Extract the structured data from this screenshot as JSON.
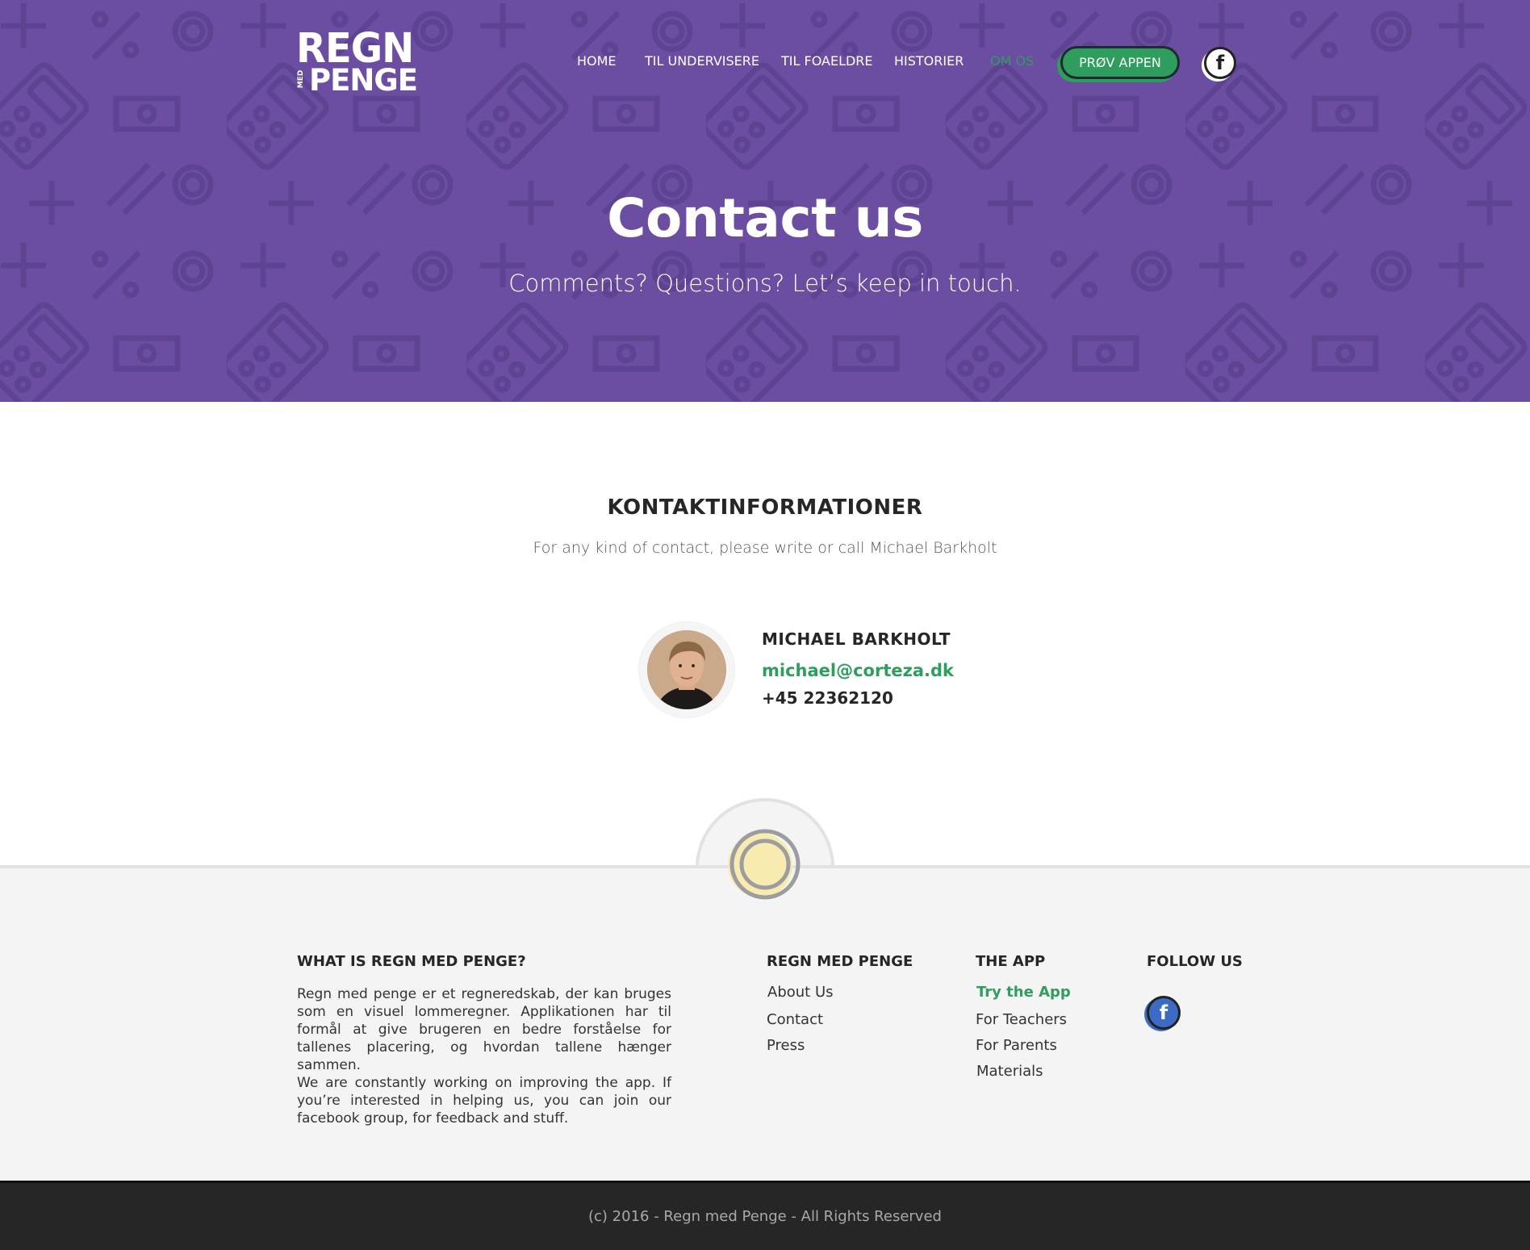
{
  "brand": {
    "logo_line1": "REGN",
    "logo_small": "MED",
    "logo_line2": "PENGE"
  },
  "nav": {
    "items": [
      {
        "label": "HOME"
      },
      {
        "label": "TIL UNDERVISERE"
      },
      {
        "label": "TIL FOAELDRE"
      },
      {
        "label": "HISTORIER"
      },
      {
        "label": "OM OS",
        "active": true
      }
    ],
    "cta_label": "PRØV APPEN",
    "facebook_icon": "facebook-icon"
  },
  "hero": {
    "title": "Contact us",
    "subtitle": "Comments? Questions? Let’s keep in touch."
  },
  "contact": {
    "title": "KONTAKTINFORMATIONER",
    "subtitle": "For any kind of contact, please write or call Michael Barkholt",
    "person": {
      "name": "MICHAEL BARKHOLT",
      "email": "michael@corteza.dk",
      "phone": "+45 22362120"
    }
  },
  "footer": {
    "about_heading": "WHAT IS REGN MED PENGE?",
    "about_text": "Regn med penge er et regneredskab, der kan bruges som en visuel lommeregner. Applikationen har til formål at give brugeren en bedre forståelse for tallenes placering, og hvordan tallene hænger sammen.",
    "about_text2": "We are constantly working on improving the app. If you’re interested in helping us, you can join our facebook group, for feedback and stuff.",
    "col1_heading": "REGN MED PENGE",
    "col1_links": [
      "About Us",
      "Contact",
      "Press"
    ],
    "col2_heading": "THE APP",
    "col2_links": [
      "Try the App",
      "For Teachers",
      "For Parents",
      "Materials"
    ],
    "col3_heading": "FOLLOW US"
  },
  "copyright": "(c)  2016 - Regn med Penge  - All Rights Reserved",
  "colors": {
    "hero_purple": "#6b4ea1",
    "accent_green": "#2e9d5e",
    "footer_bg": "#f4f4f4",
    "bottom_bar": "#262626"
  }
}
